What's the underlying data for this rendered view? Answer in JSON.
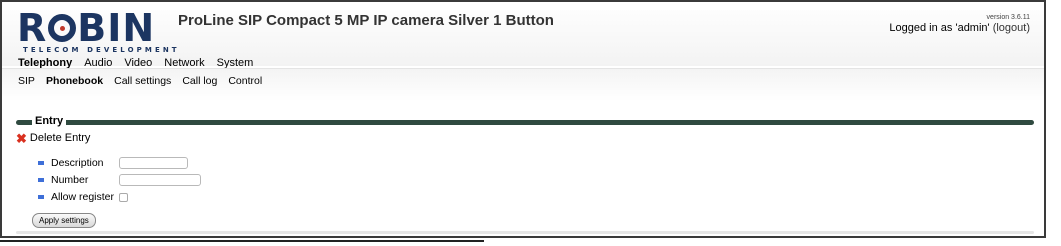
{
  "header": {
    "logo_text": "ROBIN",
    "logo_subtext": "TELECOM DEVELOPMENT",
    "title": "ProLine SIP Compact 5 MP IP camera Silver 1 Button",
    "version": "version 3.6.11",
    "login_text": "Logged in as 'admin'",
    "logout_label": "(logout)"
  },
  "topnav": [
    "Telephony",
    "Audio",
    "Video",
    "Network",
    "System"
  ],
  "subnav": [
    "SIP",
    "Phonebook",
    "Call settings",
    "Call log",
    "Control"
  ],
  "fieldset": {
    "legend": "Entry"
  },
  "delete_label": "Delete Entry",
  "form": {
    "description_label": "Description",
    "description_value": "",
    "number_label": "Number",
    "number_value": "",
    "allow_register_label": "Allow register",
    "allow_register_checked": false
  },
  "apply_label": "Apply settings"
}
